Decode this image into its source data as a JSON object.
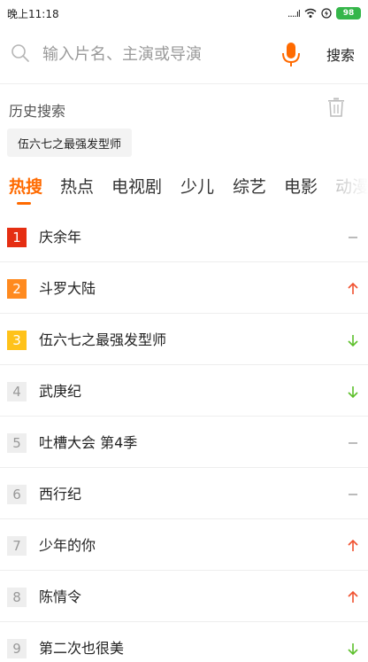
{
  "statusbar": {
    "time": "晚上11:18",
    "signal": "....ıl",
    "battery": "98"
  },
  "search": {
    "placeholder": "输入片名、主演或导演",
    "button_label": "搜索",
    "icons": {
      "search": "search-icon",
      "mic": "microphone-icon"
    },
    "mic_color": "#ff6a00"
  },
  "history": {
    "title": "历史搜索",
    "tags": [
      "伍六七之最强发型师"
    ],
    "clear_icon": "trash-icon"
  },
  "tabs": {
    "active_index": 0,
    "items": [
      "热搜",
      "热点",
      "电视剧",
      "少儿",
      "综艺",
      "电影",
      "动漫"
    ],
    "accent": "#ff6a00"
  },
  "hot_list": [
    {
      "rank": "1",
      "title": "庆余年",
      "trend": "flat"
    },
    {
      "rank": "2",
      "title": "斗罗大陆",
      "trend": "up"
    },
    {
      "rank": "3",
      "title": "伍六七之最强发型师",
      "trend": "down"
    },
    {
      "rank": "4",
      "title": "武庚纪",
      "trend": "down"
    },
    {
      "rank": "5",
      "title": "吐槽大会 第4季",
      "trend": "flat"
    },
    {
      "rank": "6",
      "title": "西行纪",
      "trend": "flat"
    },
    {
      "rank": "7",
      "title": "少年的你",
      "trend": "up"
    },
    {
      "rank": "8",
      "title": "陈情令",
      "trend": "up"
    },
    {
      "rank": "9",
      "title": "第二次也很美",
      "trend": "down"
    }
  ],
  "colors": {
    "rank1": "#e52e12",
    "rank2": "#ff8a1f",
    "rank3": "#ffc21a",
    "trend_up": "#f0502e",
    "trend_down": "#5cbf2a",
    "trend_flat": "#aaaaaa"
  }
}
